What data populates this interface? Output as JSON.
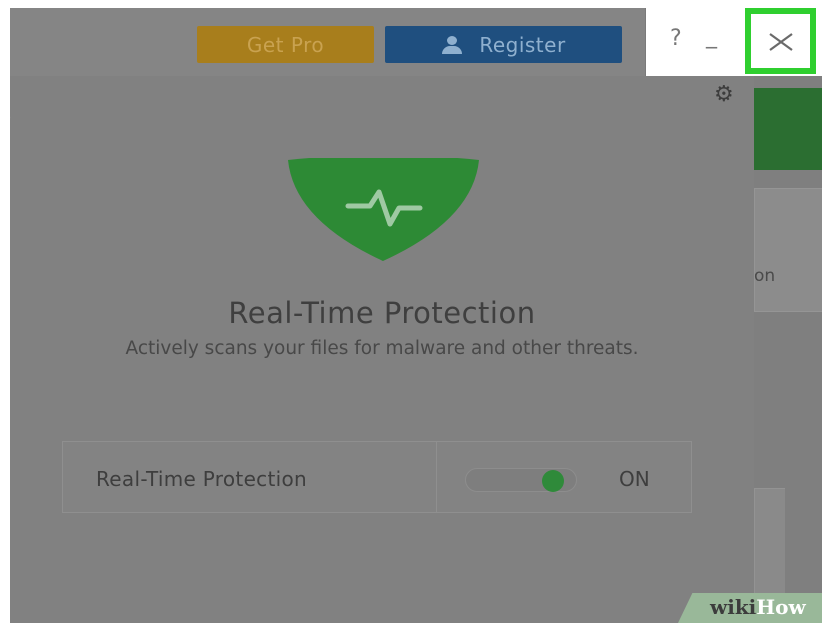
{
  "header": {
    "get_pro_label": "Get Pro",
    "register_label": "Register",
    "help_glyph": "?",
    "minimize_glyph": "_",
    "close_glyph": "×"
  },
  "panel": {
    "title": "Real-Time Protection",
    "description": "Actively scans your files for malware and other threats.",
    "toggle": {
      "label": "Real-Time Protection",
      "state_text": "ON",
      "checked": true
    }
  },
  "background": {
    "partial_text": "on"
  },
  "watermark": {
    "part1": "wiki",
    "part2": "How"
  },
  "icons": {
    "shield": "shield-heartbeat-icon",
    "settings": "gear-icon",
    "user": "user-icon",
    "close": "close-icon",
    "expand": "chevron-right-icon"
  },
  "colors": {
    "shield_green": "#2d8a35",
    "toggle_green": "#2f8a3a",
    "get_pro": "#a87e1c",
    "register": "#1f4f7f",
    "highlight": "#2fcf2f"
  }
}
